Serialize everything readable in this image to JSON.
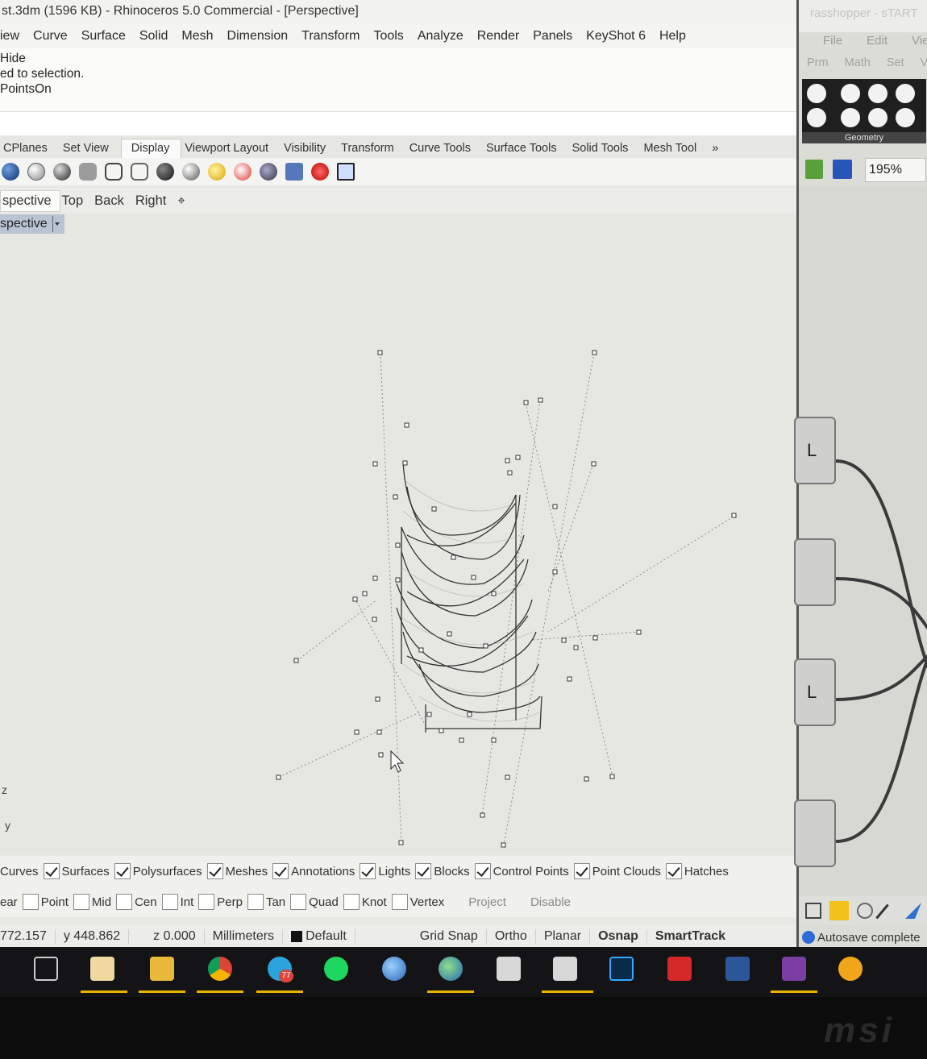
{
  "window": {
    "title": "st.3dm (1596 KB) - Rhinoceros 5.0 Commercial - [Perspective]"
  },
  "menu": [
    "iew",
    "Curve",
    "Surface",
    "Solid",
    "Mesh",
    "Dimension",
    "Transform",
    "Tools",
    "Analyze",
    "Render",
    "Panels",
    "KeyShot 6",
    "Help"
  ],
  "command_history": [
    "Hide",
    "ed to selection.",
    "PointsOn"
  ],
  "toolbar_tabs": [
    "CPlanes",
    "Set View",
    "Display",
    "Viewport Layout",
    "Visibility",
    "Transform",
    "Curve Tools",
    "Surface Tools",
    "Solid Tools",
    "Mesh Tool",
    "»"
  ],
  "active_toolbar_tab": "Display",
  "viewport_tabs": [
    "spective",
    "Top",
    "Back",
    "Right",
    "⌖"
  ],
  "viewport": {
    "name": "spective",
    "axis_z": "z",
    "axis_y": "y"
  },
  "filters": [
    {
      "label": "Curves",
      "checked": true
    },
    {
      "label": "Surfaces",
      "checked": true
    },
    {
      "label": "Polysurfaces",
      "checked": true
    },
    {
      "label": "Meshes",
      "checked": true
    },
    {
      "label": "Annotations",
      "checked": true
    },
    {
      "label": "Lights",
      "checked": true
    },
    {
      "label": "Blocks",
      "checked": true
    },
    {
      "label": "Control Points",
      "checked": true
    },
    {
      "label": "Point Clouds",
      "checked": true
    },
    {
      "label": "Hatches",
      "checked": true
    }
  ],
  "osnaps": [
    "ear",
    "Point",
    "Mid",
    "Cen",
    "Int",
    "Perp",
    "Tan",
    "Quad",
    "Knot",
    "Vertex"
  ],
  "osnap_options": [
    "Project",
    "Disable"
  ],
  "status": {
    "x": "772.157",
    "y": "y 448.862",
    "z": "z 0.000",
    "units": "Millimeters",
    "layer": "Default",
    "grid_snap": "Grid Snap",
    "ortho": "Ortho",
    "planar": "Planar",
    "osnap": "Osnap",
    "smarttrack": "SmartTrack"
  },
  "grasshopper": {
    "title": "rasshopper - sTART",
    "menu": [
      "File",
      "Edit",
      "View"
    ],
    "tabs": [
      "Prm",
      "Math",
      "Set",
      "V"
    ],
    "group": "Geometry",
    "zoom": "195%",
    "nodes": [
      "L",
      "",
      "L",
      ""
    ],
    "autosave": "Autosave complete"
  },
  "taskbar_apps": [
    "task-view",
    "paint",
    "file-explorer",
    "chrome",
    "telegram",
    "spotify",
    "earth",
    "globe",
    "calculator",
    "rhino",
    "photoshop",
    "acrobat",
    "word",
    "winrar",
    "other"
  ],
  "telegram_badge": "77",
  "brand": "msi"
}
